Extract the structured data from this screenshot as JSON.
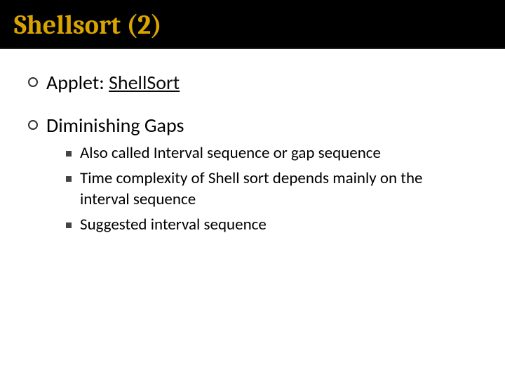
{
  "title": "Shellsort (2)",
  "items": [
    {
      "prefix": "Applet: ",
      "link": "ShellSort"
    },
    {
      "text": "Diminishing Gaps",
      "sub": [
        "Also called Interval sequence or gap sequence",
        "Time complexity of Shell sort depends mainly on the interval sequence",
        "Suggested interval sequence"
      ]
    }
  ]
}
